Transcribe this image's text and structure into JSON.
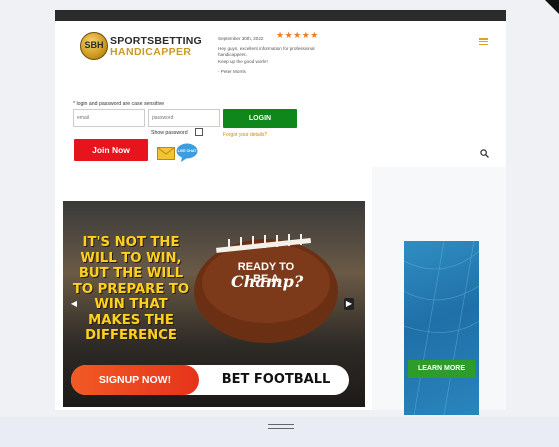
{
  "logo": {
    "badge_text": "SBH",
    "line1": "SPORTSBETTING",
    "line2": "HANDICAPPER"
  },
  "review": {
    "date": "September 30th, 2022",
    "stars": "★★★★★",
    "rating": 5,
    "text": "Hey guys, excellent information for professional handicappers.",
    "text2": "Keep up the good work!!",
    "author": "- Peter Morris"
  },
  "login": {
    "note": "* login and password are case sensitive",
    "email_placeholder": "email",
    "password_placeholder": "password",
    "login_label": "LOGIN",
    "show_password_label": "Show password",
    "forgot_label": "Forgot your details?",
    "join_label": "Join Now",
    "chat_label": "LIVE CHAT"
  },
  "slider": {
    "headline": "IT'S NOT THE WILL TO WIN, BUT THE WILL TO PREPARE TO WIN THAT MAKES THE DIFFERENCE",
    "ball_text1": "READY TO BE A",
    "ball_text2": "Champ?",
    "signup_label": "SIGNUP NOW!",
    "bet_label": "BET FOOTBALL",
    "prev_glyph": "◀",
    "next_glyph": "▶"
  },
  "side_ad": {
    "button_label": "LEARN MORE"
  },
  "colors": {
    "accent_gold": "#c89a26",
    "login_green": "#10871b",
    "join_red": "#e8141d",
    "star_orange": "#f07c1e"
  },
  "icons": [
    "hamburger-menu-icon",
    "mail-icon",
    "chat-icon",
    "search-icon",
    "chevron-left-icon",
    "chevron-right-icon",
    "drag-handle-icon"
  ]
}
